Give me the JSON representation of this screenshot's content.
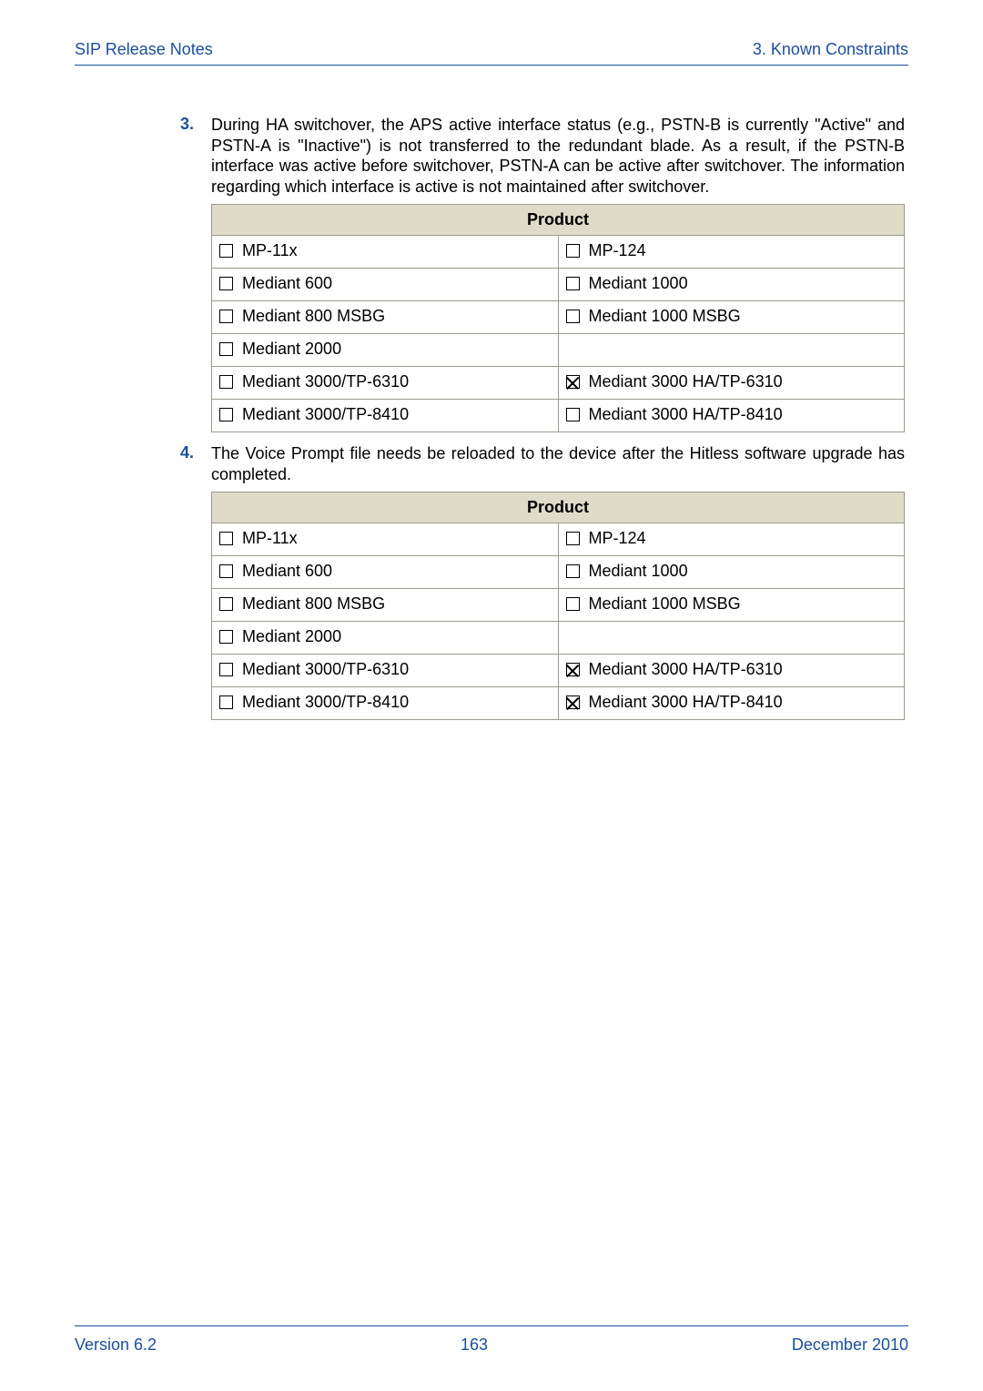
{
  "header": {
    "left": "SIP Release Notes",
    "right": "3. Known Constraints"
  },
  "items": [
    {
      "num": "3.",
      "text": "During HA switchover, the APS active interface status (e.g., PSTN-B is currently \"Active\" and PSTN-A is \"Inactive\") is not transferred to the redundant blade. As a result, if the PSTN-B interface was active before switchover, PSTN-A can be active after switchover. The information regarding which interface is active is not maintained after switchover.",
      "table_header": "Product",
      "rows": [
        {
          "l": "MP-11x",
          "lc": false,
          "r": "MP-124",
          "rc": false
        },
        {
          "l": "Mediant 600",
          "lc": false,
          "r": "Mediant 1000",
          "rc": false
        },
        {
          "l": "Mediant 800 MSBG",
          "lc": false,
          "r": "Mediant 1000 MSBG",
          "rc": false
        },
        {
          "l": "Mediant 2000",
          "lc": false,
          "r": "",
          "rc": null
        },
        {
          "l": "Mediant 3000/TP-6310",
          "lc": false,
          "r": "Mediant 3000 HA/TP-6310",
          "rc": true
        },
        {
          "l": "Mediant 3000/TP-8410",
          "lc": false,
          "r": "Mediant 3000 HA/TP-8410",
          "rc": false
        }
      ]
    },
    {
      "num": "4.",
      "text": "The Voice Prompt file needs be reloaded to the device after the Hitless software upgrade has completed.",
      "table_header": "Product",
      "rows": [
        {
          "l": "MP-11x",
          "lc": false,
          "r": "MP-124",
          "rc": false
        },
        {
          "l": "Mediant 600",
          "lc": false,
          "r": "Mediant 1000",
          "rc": false
        },
        {
          "l": "Mediant 800 MSBG",
          "lc": false,
          "r": "Mediant 1000 MSBG",
          "rc": false
        },
        {
          "l": "Mediant 2000",
          "lc": false,
          "r": "",
          "rc": null
        },
        {
          "l": "Mediant 3000/TP-6310",
          "lc": false,
          "r": "Mediant 3000 HA/TP-6310",
          "rc": true
        },
        {
          "l": "Mediant 3000/TP-8410",
          "lc": false,
          "r": "Mediant 3000 HA/TP-8410",
          "rc": true
        }
      ]
    }
  ],
  "footer": {
    "left": "Version 6.2",
    "center": "163",
    "right": "December 2010"
  }
}
